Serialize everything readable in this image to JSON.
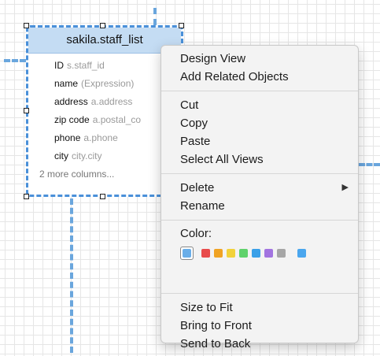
{
  "entity": {
    "title": "sakila.staff_list",
    "rows": [
      {
        "name": "ID",
        "expr": "s.staff_id"
      },
      {
        "name": "name",
        "expr": "(Expression)"
      },
      {
        "name": "address",
        "expr": "a.address"
      },
      {
        "name": "zip code",
        "expr": "a.postal_co"
      },
      {
        "name": "phone",
        "expr": "a.phone"
      },
      {
        "name": "city",
        "expr": "city.city"
      }
    ],
    "more": "2 more columns..."
  },
  "menu": {
    "design_view": "Design View",
    "add_related": "Add Related Objects",
    "cut": "Cut",
    "copy": "Copy",
    "paste": "Paste",
    "select_all_views": "Select All Views",
    "delete": "Delete",
    "rename": "Rename",
    "color_label": "Color:",
    "size_to_fit": "Size to Fit",
    "bring_to_front": "Bring to Front",
    "send_to_back": "Send to Back"
  },
  "colors": {
    "selected": "#6aaee8",
    "swatches": [
      "#e84c4c",
      "#f0a324",
      "#f2d23a",
      "#5fd26b",
      "#3aa0e8",
      "#a274e0",
      "#a6a6a6"
    ],
    "last": "#4aa6ee",
    "connector": "#6aa6dd",
    "selection": "#4a90d9"
  }
}
